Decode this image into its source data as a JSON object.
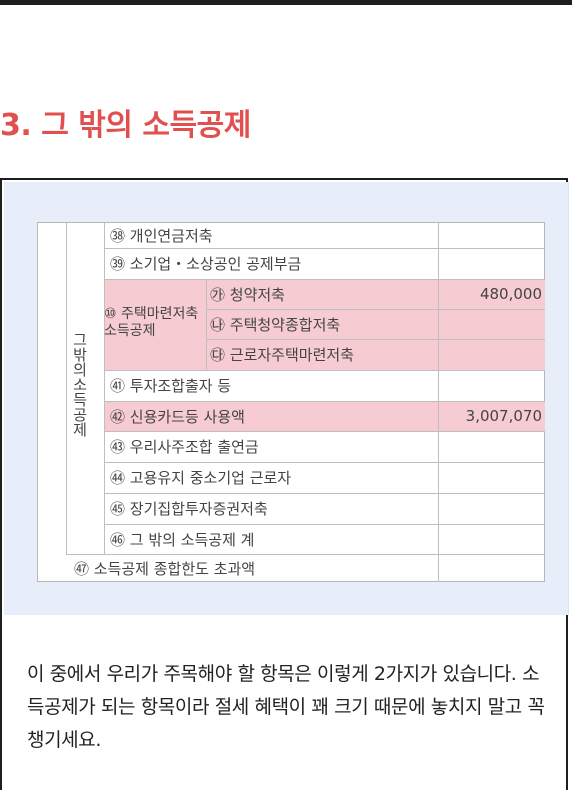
{
  "heading": "3. 그 밖의 소득공제",
  "table": {
    "group_label_vertical": "그밖의소득공제",
    "housing_group_label": "⑩ 주택마련저축소득공제",
    "rows": [
      {
        "label": "㊳ 개인연금저축",
        "amount": ""
      },
      {
        "label": "㊴ 소기업・소상공인 공제부금",
        "amount": ""
      },
      {
        "label": "㉮ 청약저축",
        "amount": "480,000"
      },
      {
        "label": "㉯ 주택청약종합저축",
        "amount": ""
      },
      {
        "label": "㉰ 근로자주택마련저축",
        "amount": ""
      },
      {
        "label": "㊶ 투자조합출자 등",
        "amount": ""
      },
      {
        "label": "㊷ 신용카드등 사용액",
        "amount": "3,007,070"
      },
      {
        "label": "㊸ 우리사주조합 출연금",
        "amount": ""
      },
      {
        "label": "㊹ 고용유지 중소기업 근로자",
        "amount": ""
      },
      {
        "label": "㊺ 장기집합투자증권저축",
        "amount": ""
      },
      {
        "label": "㊻ 그 밖의 소득공제 계",
        "amount": ""
      }
    ],
    "footer_label": "㊼ 소득공제 종합한도 초과액",
    "highlight_color": "#f6ccd2"
  },
  "paragraph": "이 중에서 우리가 주목해야 할 항목은 이렇게 2가지가 있습니다. 소득공제가 되는 항목이라 절세 혜택이 꽤 크기 때문에 놓치지 말고 꼭 챙기세요."
}
